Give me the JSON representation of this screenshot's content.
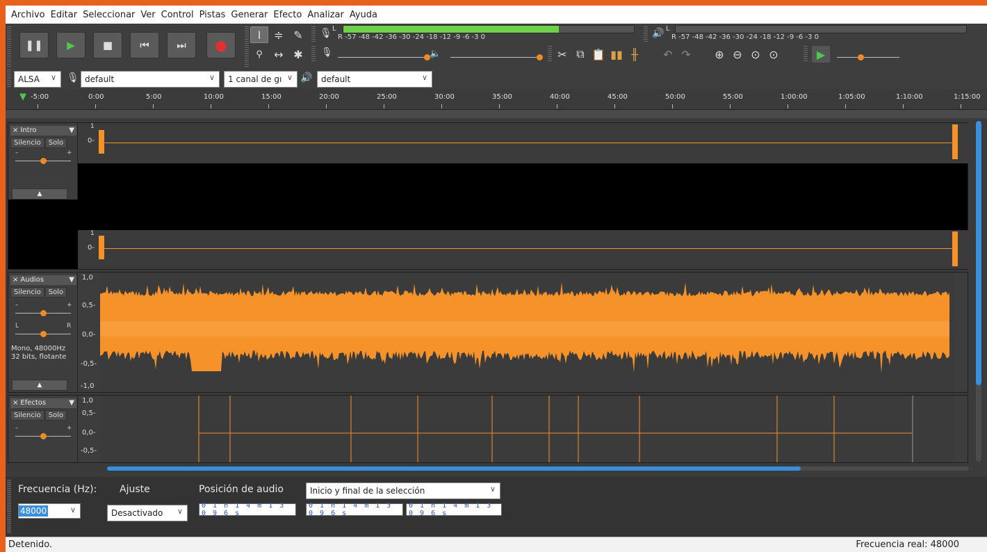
{
  "menu": [
    "Archivo",
    "Editar",
    "Seleccionar",
    "Ver",
    "Control",
    "Pistas",
    "Generar",
    "Efecto",
    "Analizar",
    "Ayuda"
  ],
  "transport": {
    "pause": "pause-icon",
    "play": "play-icon",
    "stop": "stop-icon",
    "skip_start": "skip-start-icon",
    "skip_end": "skip-end-icon",
    "record": "record-icon"
  },
  "tools": {
    "select": "I",
    "envelope": "≑",
    "draw": "✎",
    "zoom": "🔍",
    "timeshift": "↔",
    "multi": "✱"
  },
  "meters": {
    "record_scale": "R  -57  -48  -42  -36  -30  -24  -18  -12 -9 -6 -3 0",
    "play_scale": "R  -57   -48  -42  -36  -30  -24  -18  -12 -9 -6 -3 0",
    "record_lr": "L",
    "play_lr": "L"
  },
  "device": {
    "host": "ALSA",
    "record_device": "default",
    "channels": "1 canal de gı",
    "play_device": "default"
  },
  "ruler": [
    "-5:00",
    "0:00",
    "5:00",
    "10:00",
    "15:00",
    "20:00",
    "25:00",
    "30:00",
    "35:00",
    "40:00",
    "45:00",
    "50:00",
    "55:00",
    "1:00:00",
    "1:05:00",
    "1:10:00",
    "1:15:00"
  ],
  "tracks": [
    {
      "name": "Intro",
      "mute": "Silencio",
      "solo": "Solo",
      "scale_top": "1",
      "scale_mid": "0-",
      "scale_top2": "1",
      "scale_mid2": "0-"
    },
    {
      "name": "Audios",
      "mute": "Silencio",
      "solo": "Solo",
      "pan_l": "L",
      "pan_r": "R",
      "info1": "Mono, 48000Hz",
      "info2": "32 bits, flotante",
      "scale": [
        "1,0",
        "0,5-",
        "0,0-",
        "-0,5-",
        "-1,0"
      ]
    },
    {
      "name": "Efectos",
      "mute": "Silencio",
      "solo": "Solo",
      "scale": [
        "1,0",
        "0,5-",
        "0,0-",
        "-0,5-"
      ]
    }
  ],
  "gain_minus": "–",
  "gain_plus": "+",
  "collapse_glyph": "▲",
  "bottom": {
    "rate_label": "Frecuencia (Hz):",
    "rate_value": "48000",
    "snap_label": "Ajuste",
    "snap_value": "Desactivado",
    "pos_label": "Posición de audio",
    "selection_mode": "Inicio y final de la selección",
    "time": "0 1 h 1 4 m 1 3 0 9 6 s"
  },
  "status": {
    "left": "Detenido.",
    "right": "Frecuencia real: 48000"
  },
  "colors": {
    "wave": "#f5922a",
    "accent": "#e8621e",
    "meter_green": "#6fd14a",
    "record": "#e03030"
  }
}
